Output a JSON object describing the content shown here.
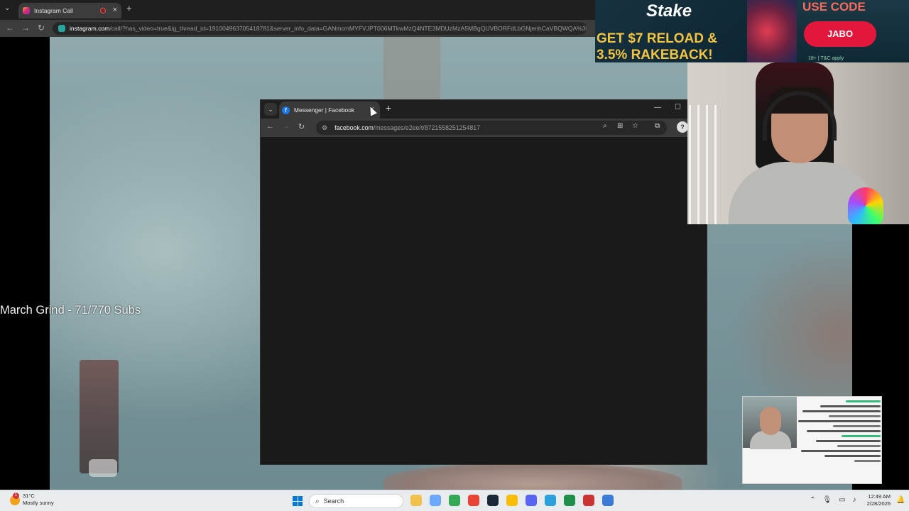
{
  "bg_browser": {
    "tab_title": "Instagram Call",
    "url_host": "instagram.com",
    "url_path": "/call/?has_video=true&ig_thread_id=191004963705418781&server_info_data=GANmcmMYFVJPT006MTkwMzQ4NTE3MDUzMzA5MBgQUVBORFdLbGNjenhCaVBQWQA%3D"
  },
  "overlay_text": "March Grind - 71/770 Subs",
  "fb_browser": {
    "tab_title": "Messenger | Facebook",
    "url_host": "facebook.com",
    "url_path": "/messages/e2ee/t/8721558251254817"
  },
  "ad": {
    "brand": "Stake",
    "line1": "GET $7 RELOAD &",
    "line2": "3.5% RAKEBACK!",
    "use_code": "USE CODE",
    "code": "JABO",
    "terms": "18+ | T&C apply"
  },
  "taskbar": {
    "weather_temp": "31°C",
    "weather_desc": "Mostly sunny",
    "weather_badge": "1",
    "search_placeholder": "Search",
    "time": "12:49 AM",
    "date": "2/28/2026",
    "apps": [
      {
        "name": "file-explorer",
        "color": "#f2c14b"
      },
      {
        "name": "copilot",
        "color": "#6aa9ff"
      },
      {
        "name": "chrome",
        "color": "#34a853"
      },
      {
        "name": "chrome-alt",
        "color": "#ea4335"
      },
      {
        "name": "steam",
        "color": "#1b2838"
      },
      {
        "name": "chrome-profile",
        "color": "#fbbc05"
      },
      {
        "name": "discord",
        "color": "#5865f2"
      },
      {
        "name": "telegram",
        "color": "#2aa1da"
      },
      {
        "name": "app-green",
        "color": "#1f8f4a"
      },
      {
        "name": "app-red",
        "color": "#c33"
      },
      {
        "name": "snipping-tool",
        "color": "#3a7bd5"
      }
    ]
  }
}
